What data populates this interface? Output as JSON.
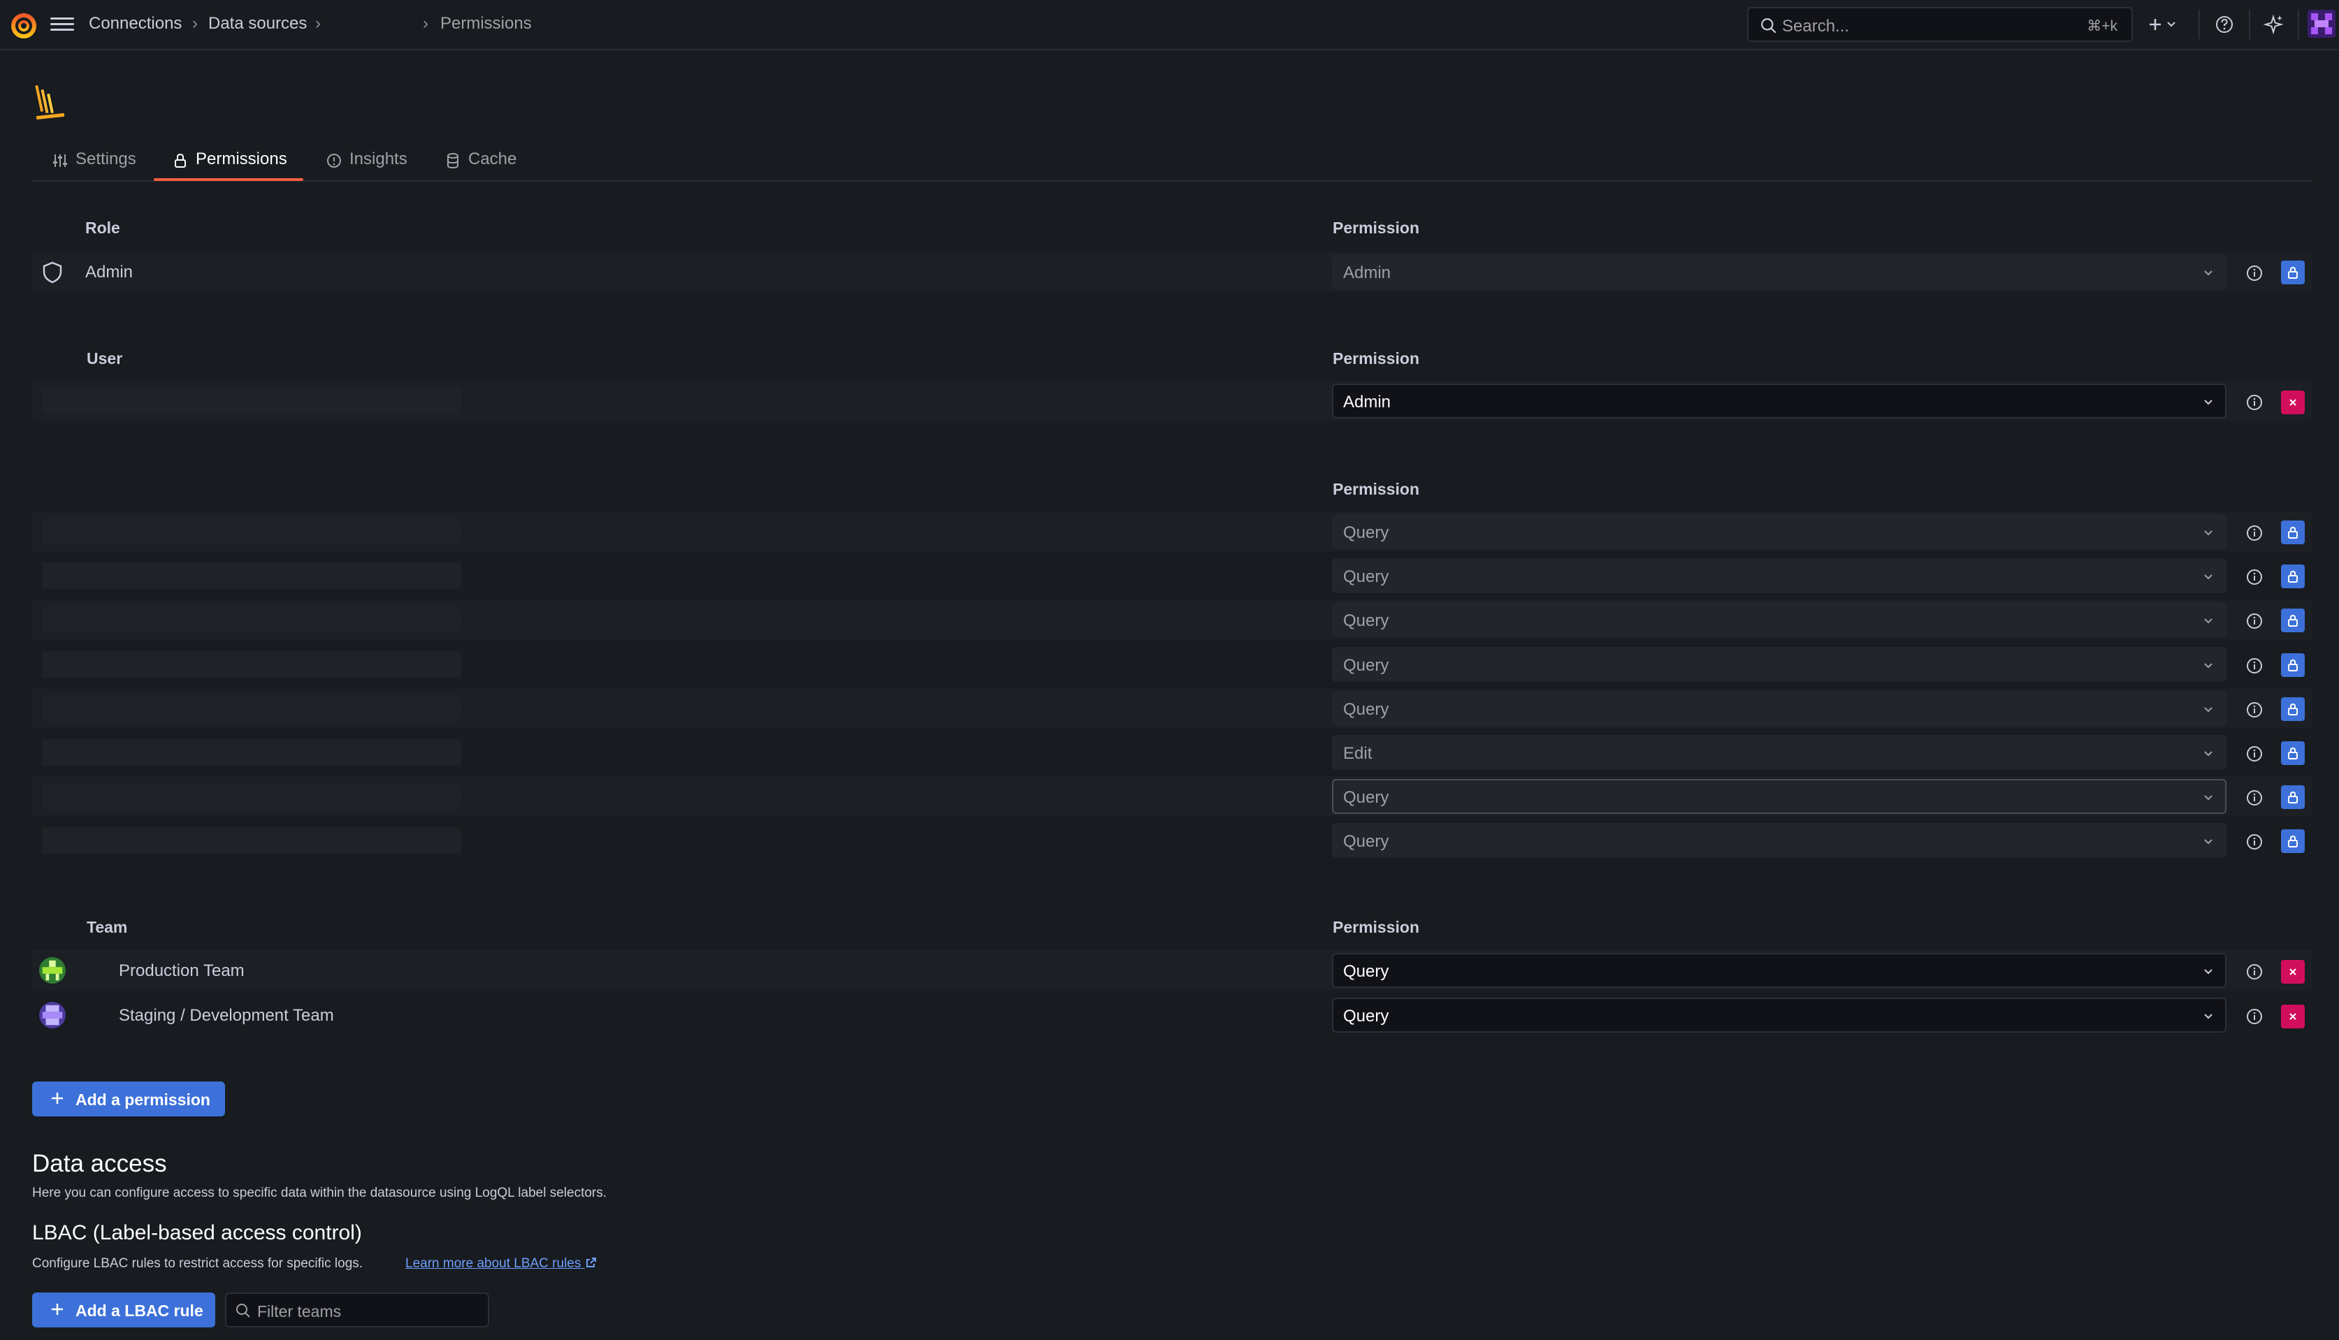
{
  "breadcrumb": {
    "items": [
      "Connections",
      "Data sources",
      "Permissions"
    ],
    "separator": "›"
  },
  "search": {
    "placeholder": "Search...",
    "shortcut": "⌘+k"
  },
  "tabs": [
    {
      "label": "Settings",
      "icon": "sliders-icon"
    },
    {
      "label": "Permissions",
      "icon": "lock-icon",
      "active": true
    },
    {
      "label": "Insights",
      "icon": "info-circle-icon"
    },
    {
      "label": "Cache",
      "icon": "database-icon"
    }
  ],
  "role_section": {
    "column_label": "Role",
    "permission_label": "Permission",
    "rows": [
      {
        "name": "Admin",
        "permission": "Admin",
        "action": "locked"
      }
    ]
  },
  "user_section": {
    "column_label": "User",
    "permission_label": "Permission",
    "rows": [
      {
        "permission": "Admin",
        "action": "remove"
      }
    ]
  },
  "inherited_section": {
    "permission_label": "Permission",
    "rows": [
      {
        "permission": "Query"
      },
      {
        "permission": "Query"
      },
      {
        "permission": "Query"
      },
      {
        "permission": "Query"
      },
      {
        "permission": "Query"
      },
      {
        "permission": "Edit"
      },
      {
        "permission": "Query"
      },
      {
        "permission": "Query"
      }
    ]
  },
  "team_section": {
    "column_label": "Team",
    "permission_label": "Permission",
    "rows": [
      {
        "name": "Production Team",
        "permission": "Query",
        "action": "remove"
      },
      {
        "name": "Staging / Development Team",
        "permission": "Query",
        "action": "remove"
      }
    ]
  },
  "add_permission_label": "Add a permission",
  "data_access": {
    "title": "Data access",
    "description": "Here you can configure access to specific data within the datasource using LogQL label selectors."
  },
  "lbac": {
    "title": "LBAC (Label-based access control)",
    "description": "Configure LBAC rules to restrict access for specific logs.",
    "link_label": "Learn more about LBAC rules",
    "add_label": "Add a LBAC rule",
    "filter_placeholder": "Filter teams"
  },
  "colors": {
    "background": "#181b1f",
    "primary": "#3d71d9",
    "danger": "#d10e5c",
    "tab_active_underline": "#f55f3e",
    "link": "#6e9fff"
  }
}
